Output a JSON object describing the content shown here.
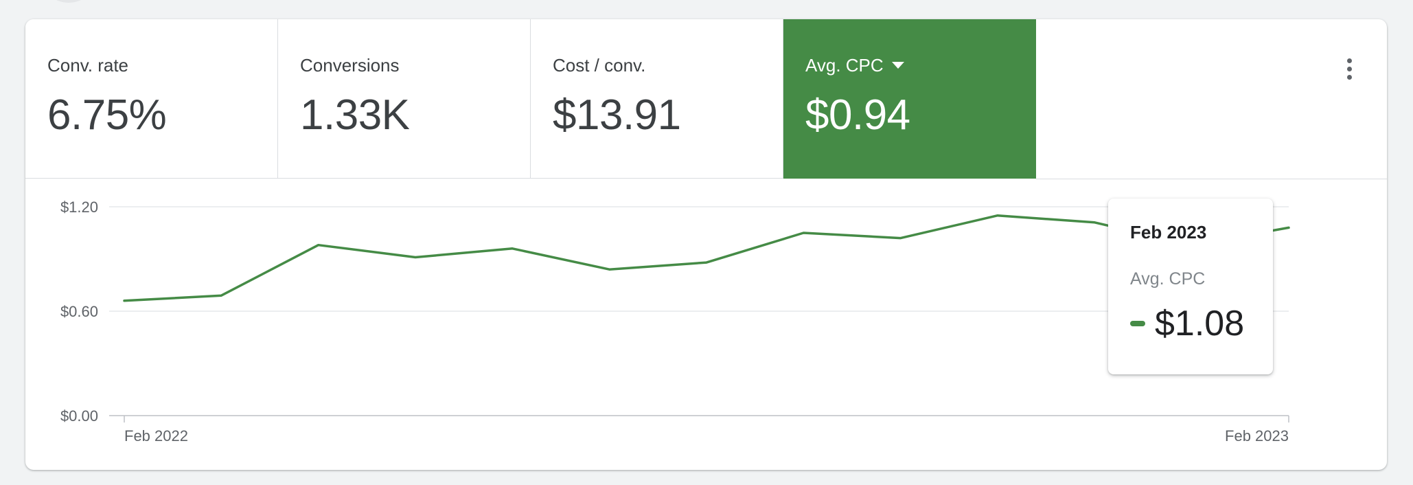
{
  "metrics": [
    {
      "label": "Conv. rate",
      "value": "6.75%",
      "active": false
    },
    {
      "label": "Conversions",
      "value": "1.33K",
      "active": false
    },
    {
      "label": "Cost / conv.",
      "value": "$13.91",
      "active": false
    },
    {
      "label": "Avg. CPC",
      "value": "$0.94",
      "active": true
    }
  ],
  "menu": {
    "icon": "more-vert-icon"
  },
  "colors": {
    "accent": "#458b46",
    "line": "#458b46",
    "grid": "#dadce0",
    "text": "#3c4043"
  },
  "chart_data": {
    "type": "line",
    "x": [
      "2022-02",
      "2022-03",
      "2022-04",
      "2022-05",
      "2022-06",
      "2022-07",
      "2022-08",
      "2022-09",
      "2022-10",
      "2022-11",
      "2022-12",
      "2023-01",
      "2023-02"
    ],
    "series": [
      {
        "values": [
          0.66,
          0.69,
          0.98,
          0.91,
          0.96,
          0.84,
          0.88,
          1.05,
          1.02,
          1.15,
          1.11,
          0.98,
          1.08
        ]
      }
    ],
    "ylim": [
      0,
      1.2
    ],
    "yticks": [
      "$0.00",
      "$0.60",
      "$1.20"
    ],
    "ytick_values": [
      0,
      0.6,
      1.2
    ],
    "xtick_labels": [
      "Feb 2022",
      "Feb 2023"
    ],
    "grid": true
  },
  "tooltip": {
    "title": "Feb 2023",
    "metric": "Avg. CPC",
    "value": "$1.08"
  }
}
